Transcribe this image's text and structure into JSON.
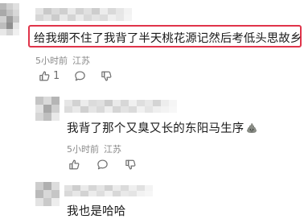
{
  "comments": [
    {
      "text": "给我绷不住了我背了半天桃花源记然后考低头思故乡",
      "time": "5小时前",
      "location": "江苏",
      "like_count": "1"
    },
    {
      "text": "我背了那个又臭又长的东阳马生序",
      "time": "5小时前",
      "location": "江苏"
    },
    {
      "text": "我也是哈哈"
    }
  ],
  "icons": {
    "like": "thumbs-up-icon",
    "reply": "comment-bubble-icon",
    "dislike": "thumbs-down-icon",
    "emoji": "poop-emoji-icon"
  },
  "colors": {
    "highlight_border": "#e0344a",
    "meta_text": "#8a8a8a",
    "icon_gray": "#707070"
  }
}
